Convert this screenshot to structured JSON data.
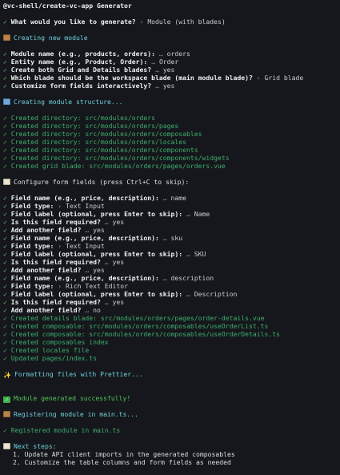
{
  "colors": {
    "background": "#15171c",
    "success": "#56c25a",
    "created": "#3fae6b",
    "info": "#6fcfdc"
  },
  "title": "@vc-shell/create-vc-app Generator",
  "q_generate": {
    "mark": "✓",
    "question": "What would you like to generate?",
    "arrow": "›",
    "answer": "Module (with blades)"
  },
  "creating_module": {
    "icon": "package-icon",
    "text": "Creating new module"
  },
  "prompts1": [
    {
      "mark": "✓",
      "question": "Module name (e.g., products, orders):",
      "sep": "…",
      "answer": "orders"
    },
    {
      "mark": "✓",
      "question": "Entity name (e.g., Product, Order):",
      "sep": "…",
      "answer": "Order"
    },
    {
      "mark": "✓",
      "question": "Create both Grid and Details blades?",
      "sep": "…",
      "answer": "yes"
    },
    {
      "mark": "✓",
      "question": "Which blade should be the workspace blade (main module blade)?",
      "sep": "›",
      "answer": "Grid blade"
    },
    {
      "mark": "✓",
      "question": "Customize form fields interactively?",
      "sep": "…",
      "answer": "yes"
    }
  ],
  "structure": {
    "icon": "folder-icon",
    "text": "Creating module structure..."
  },
  "created1": [
    "✓ Created directory: src/modules/orders",
    "✓ Created directory: src/modules/orders/pages",
    "✓ Created directory: src/modules/orders/composables",
    "✓ Created directory: src/modules/orders/locales",
    "✓ Created directory: src/modules/orders/components",
    "✓ Created directory: src/modules/orders/components/widgets",
    "✓ Created grid blade: src/modules/orders/pages/orders.vue"
  ],
  "configure": {
    "icon": "memo-icon",
    "text": "Configure form fields (press Ctrl+C to skip):"
  },
  "prompts2": [
    {
      "mark": "✓",
      "question": "Field name (e.g., price, description):",
      "sep": "…",
      "answer": "name"
    },
    {
      "mark": "✓",
      "question": "Field type:",
      "sep": "›",
      "answer": "Text Input"
    },
    {
      "mark": "✓",
      "question": "Field label (optional, press Enter to skip):",
      "sep": "…",
      "answer": "Name"
    },
    {
      "mark": "✓",
      "question": "Is this field required?",
      "sep": "…",
      "answer": "yes"
    },
    {
      "mark": "✓",
      "question": "Add another field?",
      "sep": "…",
      "answer": "yes"
    },
    {
      "mark": "✓",
      "question": "Field name (e.g., price, description):",
      "sep": "…",
      "answer": "sku"
    },
    {
      "mark": "✓",
      "question": "Field type:",
      "sep": "›",
      "answer": "Text Input"
    },
    {
      "mark": "✓",
      "question": "Field label (optional, press Enter to skip):",
      "sep": "…",
      "answer": "SKU"
    },
    {
      "mark": "✓",
      "question": "Is this field required?",
      "sep": "…",
      "answer": "yes"
    },
    {
      "mark": "✓",
      "question": "Add another field?",
      "sep": "…",
      "answer": "yes"
    },
    {
      "mark": "✓",
      "question": "Field name (e.g., price, description):",
      "sep": "…",
      "answer": "description"
    },
    {
      "mark": "✓",
      "question": "Field type:",
      "sep": "›",
      "answer": "Rich Text Editor"
    },
    {
      "mark": "✓",
      "question": "Field label (optional, press Enter to skip):",
      "sep": "…",
      "answer": "Description"
    },
    {
      "mark": "✓",
      "question": "Is this field required?",
      "sep": "…",
      "answer": "yes"
    },
    {
      "mark": "✓",
      "question": "Add another field?",
      "sep": "…",
      "answer": "no"
    }
  ],
  "created2": [
    "✓ Created details blade: src/modules/orders/pages/order-details.vue",
    "✓ Created composable: src/modules/orders/composables/useOrderList.ts",
    "✓ Created composable: src/modules/orders/composables/useOrderDetails.ts",
    "✓ Created composables index",
    "✓ Created locales file",
    "✓ Updated pages/index.ts"
  ],
  "formatting": {
    "icon": "sparkles-icon",
    "text": "Formatting files with Prettier..."
  },
  "success": {
    "icon": "check-mark-button-icon",
    "text": "Module generated successfully!"
  },
  "registering": {
    "icon": "package-icon",
    "text": "Registering module in main.ts..."
  },
  "registered": "✓ Registered module in main.ts",
  "next": {
    "icon": "memo-icon",
    "heading": "Next steps:",
    "steps": [
      "1. Update API client imports in the generated composables",
      "2. Customize the table columns and form fields as needed"
    ]
  }
}
